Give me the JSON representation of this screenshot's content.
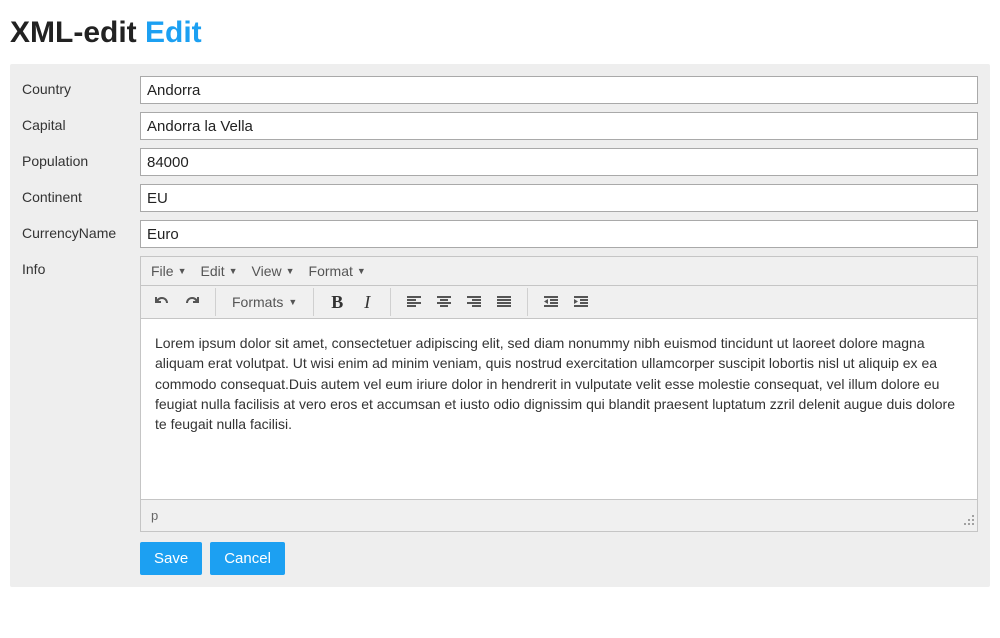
{
  "title": {
    "prefix": "XML-edit",
    "accent": "Edit"
  },
  "labels": {
    "country": "Country",
    "capital": "Capital",
    "population": "Population",
    "continent": "Continent",
    "currency": "CurrencyName",
    "info": "Info"
  },
  "values": {
    "country": "Andorra",
    "capital": "Andorra la Vella",
    "population": "84000",
    "continent": "EU",
    "currency": "Euro",
    "info_body": "Lorem ipsum dolor sit amet, consectetuer adipiscing elit, sed diam nonummy nibh euismod tincidunt ut laoreet dolore magna aliquam erat volutpat. Ut wisi enim ad minim veniam, quis nostrud exercitation ullamcorper suscipit lobortis nisl ut aliquip ex ea commodo consequat.Duis autem vel eum iriure dolor in hendrerit in vulputate velit esse molestie consequat, vel illum dolore eu feugiat nulla facilisis at vero eros et accumsan et iusto odio dignissim qui blandit praesent luptatum zzril delenit augue duis dolore te feugait nulla facilisi."
  },
  "editor": {
    "menu": {
      "file": "File",
      "edit": "Edit",
      "view": "View",
      "format": "Format"
    },
    "toolbar": {
      "formats": "Formats"
    },
    "status": "p"
  },
  "buttons": {
    "save": "Save",
    "cancel": "Cancel"
  }
}
